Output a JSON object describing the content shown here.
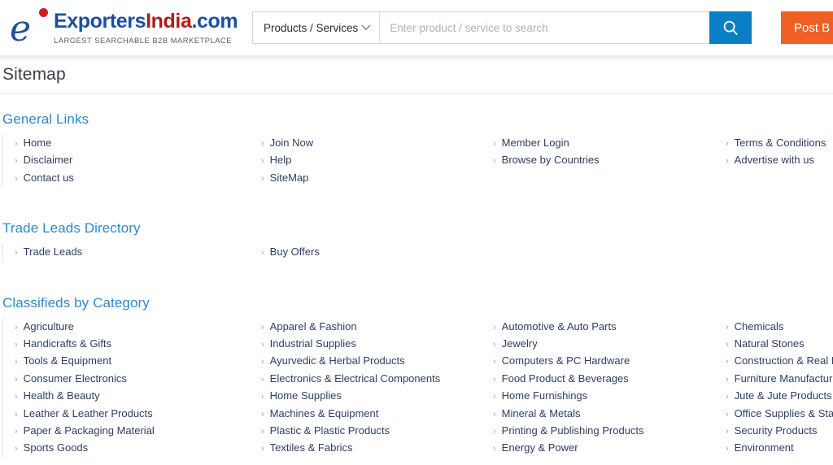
{
  "header": {
    "logo": {
      "name_blue_1": "Exporters",
      "name_red": "India",
      "name_blue_2": ".com",
      "tagline": "LARGEST SEARCHABLE B2B MARKETPLACE"
    },
    "search": {
      "category_label": "Products / Services",
      "placeholder": "Enter product / service to search",
      "value": "",
      "search_icon": "search-icon",
      "chevron_icon": "chevron-down-icon"
    },
    "post_button_label": "Post B"
  },
  "page": {
    "title": "Sitemap"
  },
  "sections": [
    {
      "title": "General Links",
      "columns": [
        [
          "Home",
          "Disclaimer",
          "Contact us"
        ],
        [
          "Join Now",
          "Help",
          "SiteMap"
        ],
        [
          "Member Login",
          "Browse by Countries"
        ],
        [
          "Terms & Conditions",
          "Advertise with us"
        ]
      ]
    },
    {
      "title": "Trade Leads Directory",
      "columns": [
        [
          "Trade Leads"
        ],
        [
          "Buy Offers"
        ],
        [],
        []
      ]
    },
    {
      "title": "Classifieds by Category",
      "columns": [
        [
          "Agriculture",
          "Handicrafts & Gifts",
          "Tools & Equipment",
          "Consumer Electronics",
          "Health & Beauty",
          "Leather & Leather Products",
          "Paper & Packaging Material",
          "Sports Goods"
        ],
        [
          "Apparel & Fashion",
          "Industrial Supplies",
          "Ayurvedic & Herbal Products",
          "Electronics & Electrical Components",
          "Home Supplies",
          "Machines & Equipment",
          "Plastic & Plastic Products",
          "Textiles & Fabrics"
        ],
        [
          "Automotive & Auto Parts",
          "Jewelry",
          "Computers & PC Hardware",
          "Food Product & Beverages",
          "Home Furnishings",
          "Mineral & Metals",
          "Printing & Publishing Products",
          "Energy & Power"
        ],
        [
          "Chemicals",
          "Natural Stones",
          "Construction & Real Estate",
          "Furniture Manufacturers",
          "Jute & Jute Products",
          "Office Supplies & Stationery",
          "Security Products",
          "Environment"
        ]
      ]
    }
  ],
  "colors": {
    "brand_blue": "#1b4f9e",
    "brand_red": "#b01c1c",
    "section_heading": "#2e89c8",
    "link": "#2c3f63",
    "search_button": "#0b7fc4",
    "post_button": "#ef6024"
  },
  "bullet_glyph": "›"
}
